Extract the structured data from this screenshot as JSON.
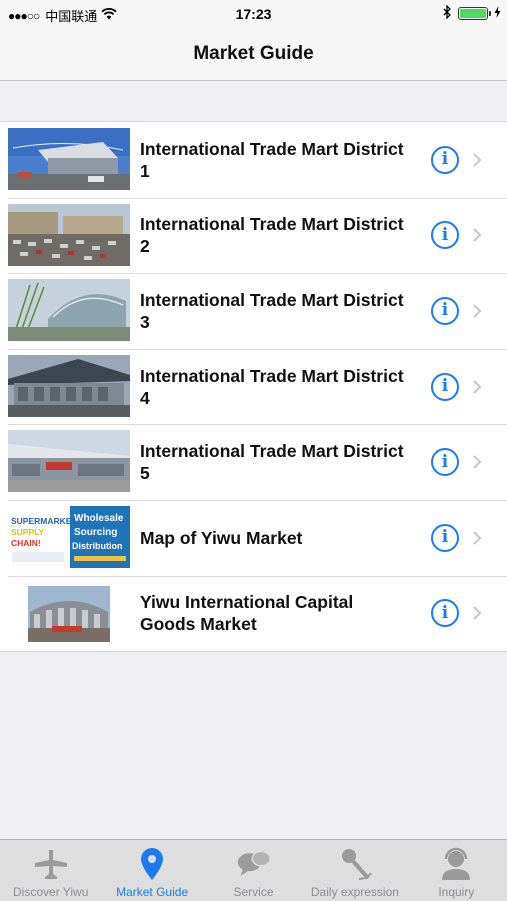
{
  "status_bar": {
    "signal": "●●●○○",
    "carrier": "中国联通",
    "time": "17:23"
  },
  "nav": {
    "title": "Market Guide"
  },
  "list": {
    "items": [
      {
        "label": "International Trade Mart District 1"
      },
      {
        "label": "International Trade Mart District 2"
      },
      {
        "label": "International Trade Mart District 3"
      },
      {
        "label": "International Trade Mart District 4"
      },
      {
        "label": "International Trade Mart District 5"
      },
      {
        "label": "Map of Yiwu Market",
        "thumb_text": {
          "left": "SUPERMARKET SUPPLY CHAIN!",
          "right": "Wholesale Sourcing Distribution"
        }
      },
      {
        "label": "Yiwu International Capital Goods Market"
      }
    ],
    "info_glyph": "i"
  },
  "tabs": [
    {
      "label": "Discover Yiwu",
      "icon": "airplane-icon",
      "active": false
    },
    {
      "label": "Market Guide",
      "icon": "location-pin-icon",
      "active": true
    },
    {
      "label": "Service",
      "icon": "chat-bubbles-icon",
      "active": false
    },
    {
      "label": "Daily expression",
      "icon": "microphone-icon",
      "active": false
    },
    {
      "label": "Inquiry",
      "icon": "headset-agent-icon",
      "active": false
    }
  ],
  "colors": {
    "accent": "#1a7cf0",
    "battery": "#4cd964",
    "inactive_tab": "#8e8e93"
  }
}
